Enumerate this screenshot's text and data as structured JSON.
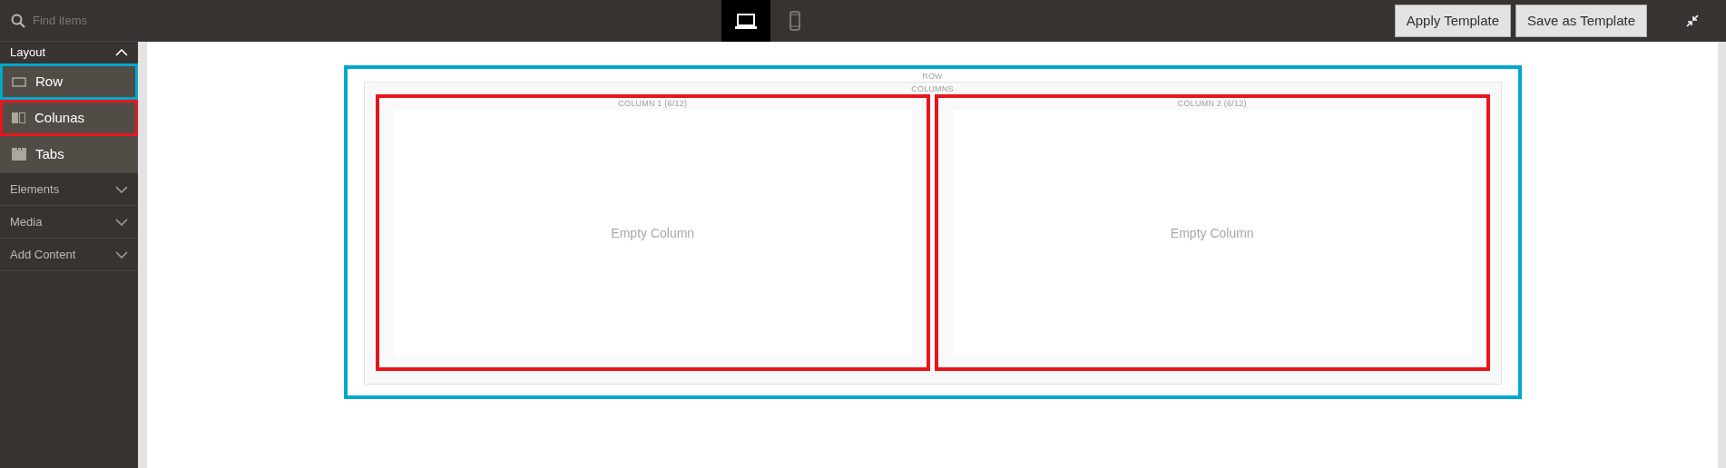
{
  "search": {
    "placeholder": "Find items"
  },
  "devices": [
    {
      "kind": "desktop",
      "selected": true
    },
    {
      "kind": "mobile",
      "selected": false
    }
  ],
  "toolbar_buttons": [
    "Apply Template",
    "Save as Template"
  ],
  "sidebar": {
    "groups": [
      {
        "label": "Layout",
        "expanded": true,
        "items": [
          {
            "kind": "row",
            "label": "Row",
            "color": "#00a8cc"
          },
          {
            "kind": "columns",
            "label": "Colunas",
            "color": "#e8161c"
          },
          {
            "kind": "tabs",
            "label": "Tabs"
          }
        ]
      },
      {
        "label": "Elements",
        "expanded": false
      },
      {
        "label": "Media",
        "expanded": false
      },
      {
        "label": "Add Content",
        "expanded": false
      }
    ]
  },
  "stage": {
    "row": {
      "label": "ROW",
      "color": "#00a8cc",
      "columns_label": "COLUMNS",
      "columns": [
        {
          "label": "COLUMN 1 (6/12)",
          "placeholder": "Empty Column",
          "color": "#e8161c"
        },
        {
          "label": "COLUMN 2 (6/12)",
          "placeholder": "Empty Column",
          "color": "#e8161c"
        }
      ]
    }
  }
}
